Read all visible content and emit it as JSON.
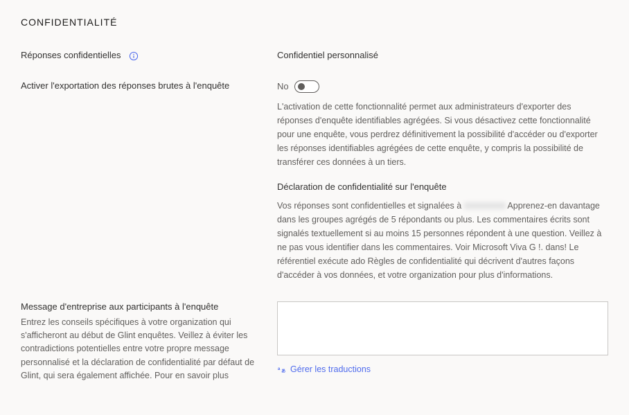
{
  "section": {
    "title": "CONFIDENTIALITÉ"
  },
  "confidential_responses": {
    "label": "Réponses confidentielles",
    "value": "Confidentiel personnalisé"
  },
  "raw_export": {
    "label": "Activer l'exportation des réponses brutes à l'enquête",
    "toggle_value": "No",
    "description": "L'activation de cette fonctionnalité permet aux administrateurs d'exporter des réponses d'enquête identifiables agrégées. Si vous désactivez cette fonctionnalité pour une enquête, vous perdrez définitivement la possibilité d'accéder ou d'exporter les réponses identifiables agrégées de cette enquête, y compris la possibilité de transférer ces données à un tiers.",
    "privacy_heading": "Déclaration de confidentialité sur l'enquête",
    "privacy_text_1": "Vos réponses sont confidentielles et signalées à ",
    "privacy_text_2": " Apprenez-en davantage dans les groupes agrégés de 5 répondants ou plus. Les commentaires écrits sont signalés textuellement si au moins 15 personnes répondent à une question. Veillez à ne pas vous identifier dans les commentaires. Voir Microsoft Viva G !. dans! Le référentiel exécute ado Règles de confidentialité qui décrivent d'autres façons d'accéder à vos données, et votre organization pour plus d'informations."
  },
  "company_message": {
    "label": "Message d'entreprise aux participants à l'enquête",
    "help": "Entrez les conseils spécifiques à votre organization qui s'afficheront au début de Glint enquêtes. Veillez à éviter les contradictions potentielles entre votre propre message personnalisé et la déclaration de confidentialité par défaut de Glint, qui sera également affichée. Pour en savoir plus",
    "value": "",
    "translations_link": "Gérer les traductions"
  }
}
